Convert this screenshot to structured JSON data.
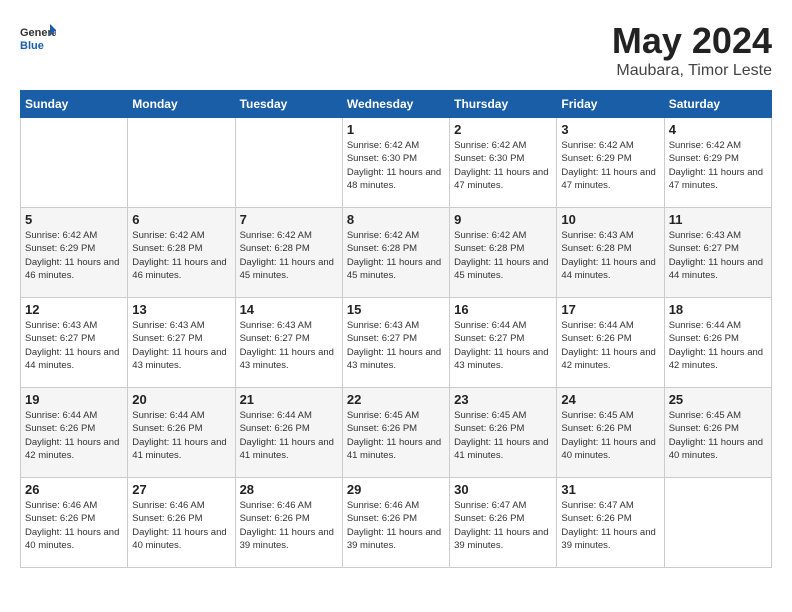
{
  "header": {
    "logo_general": "General",
    "logo_blue": "Blue",
    "title": "May 2024",
    "location": "Maubara, Timor Leste"
  },
  "weekdays": [
    "Sunday",
    "Monday",
    "Tuesday",
    "Wednesday",
    "Thursday",
    "Friday",
    "Saturday"
  ],
  "weeks": [
    [
      null,
      null,
      null,
      {
        "day": "1",
        "sunrise": "Sunrise: 6:42 AM",
        "sunset": "Sunset: 6:30 PM",
        "daylight": "Daylight: 11 hours and 48 minutes."
      },
      {
        "day": "2",
        "sunrise": "Sunrise: 6:42 AM",
        "sunset": "Sunset: 6:30 PM",
        "daylight": "Daylight: 11 hours and 47 minutes."
      },
      {
        "day": "3",
        "sunrise": "Sunrise: 6:42 AM",
        "sunset": "Sunset: 6:29 PM",
        "daylight": "Daylight: 11 hours and 47 minutes."
      },
      {
        "day": "4",
        "sunrise": "Sunrise: 6:42 AM",
        "sunset": "Sunset: 6:29 PM",
        "daylight": "Daylight: 11 hours and 47 minutes."
      }
    ],
    [
      {
        "day": "5",
        "sunrise": "Sunrise: 6:42 AM",
        "sunset": "Sunset: 6:29 PM",
        "daylight": "Daylight: 11 hours and 46 minutes."
      },
      {
        "day": "6",
        "sunrise": "Sunrise: 6:42 AM",
        "sunset": "Sunset: 6:28 PM",
        "daylight": "Daylight: 11 hours and 46 minutes."
      },
      {
        "day": "7",
        "sunrise": "Sunrise: 6:42 AM",
        "sunset": "Sunset: 6:28 PM",
        "daylight": "Daylight: 11 hours and 45 minutes."
      },
      {
        "day": "8",
        "sunrise": "Sunrise: 6:42 AM",
        "sunset": "Sunset: 6:28 PM",
        "daylight": "Daylight: 11 hours and 45 minutes."
      },
      {
        "day": "9",
        "sunrise": "Sunrise: 6:42 AM",
        "sunset": "Sunset: 6:28 PM",
        "daylight": "Daylight: 11 hours and 45 minutes."
      },
      {
        "day": "10",
        "sunrise": "Sunrise: 6:43 AM",
        "sunset": "Sunset: 6:28 PM",
        "daylight": "Daylight: 11 hours and 44 minutes."
      },
      {
        "day": "11",
        "sunrise": "Sunrise: 6:43 AM",
        "sunset": "Sunset: 6:27 PM",
        "daylight": "Daylight: 11 hours and 44 minutes."
      }
    ],
    [
      {
        "day": "12",
        "sunrise": "Sunrise: 6:43 AM",
        "sunset": "Sunset: 6:27 PM",
        "daylight": "Daylight: 11 hours and 44 minutes."
      },
      {
        "day": "13",
        "sunrise": "Sunrise: 6:43 AM",
        "sunset": "Sunset: 6:27 PM",
        "daylight": "Daylight: 11 hours and 43 minutes."
      },
      {
        "day": "14",
        "sunrise": "Sunrise: 6:43 AM",
        "sunset": "Sunset: 6:27 PM",
        "daylight": "Daylight: 11 hours and 43 minutes."
      },
      {
        "day": "15",
        "sunrise": "Sunrise: 6:43 AM",
        "sunset": "Sunset: 6:27 PM",
        "daylight": "Daylight: 11 hours and 43 minutes."
      },
      {
        "day": "16",
        "sunrise": "Sunrise: 6:44 AM",
        "sunset": "Sunset: 6:27 PM",
        "daylight": "Daylight: 11 hours and 43 minutes."
      },
      {
        "day": "17",
        "sunrise": "Sunrise: 6:44 AM",
        "sunset": "Sunset: 6:26 PM",
        "daylight": "Daylight: 11 hours and 42 minutes."
      },
      {
        "day": "18",
        "sunrise": "Sunrise: 6:44 AM",
        "sunset": "Sunset: 6:26 PM",
        "daylight": "Daylight: 11 hours and 42 minutes."
      }
    ],
    [
      {
        "day": "19",
        "sunrise": "Sunrise: 6:44 AM",
        "sunset": "Sunset: 6:26 PM",
        "daylight": "Daylight: 11 hours and 42 minutes."
      },
      {
        "day": "20",
        "sunrise": "Sunrise: 6:44 AM",
        "sunset": "Sunset: 6:26 PM",
        "daylight": "Daylight: 11 hours and 41 minutes."
      },
      {
        "day": "21",
        "sunrise": "Sunrise: 6:44 AM",
        "sunset": "Sunset: 6:26 PM",
        "daylight": "Daylight: 11 hours and 41 minutes."
      },
      {
        "day": "22",
        "sunrise": "Sunrise: 6:45 AM",
        "sunset": "Sunset: 6:26 PM",
        "daylight": "Daylight: 11 hours and 41 minutes."
      },
      {
        "day": "23",
        "sunrise": "Sunrise: 6:45 AM",
        "sunset": "Sunset: 6:26 PM",
        "daylight": "Daylight: 11 hours and 41 minutes."
      },
      {
        "day": "24",
        "sunrise": "Sunrise: 6:45 AM",
        "sunset": "Sunset: 6:26 PM",
        "daylight": "Daylight: 11 hours and 40 minutes."
      },
      {
        "day": "25",
        "sunrise": "Sunrise: 6:45 AM",
        "sunset": "Sunset: 6:26 PM",
        "daylight": "Daylight: 11 hours and 40 minutes."
      }
    ],
    [
      {
        "day": "26",
        "sunrise": "Sunrise: 6:46 AM",
        "sunset": "Sunset: 6:26 PM",
        "daylight": "Daylight: 11 hours and 40 minutes."
      },
      {
        "day": "27",
        "sunrise": "Sunrise: 6:46 AM",
        "sunset": "Sunset: 6:26 PM",
        "daylight": "Daylight: 11 hours and 40 minutes."
      },
      {
        "day": "28",
        "sunrise": "Sunrise: 6:46 AM",
        "sunset": "Sunset: 6:26 PM",
        "daylight": "Daylight: 11 hours and 39 minutes."
      },
      {
        "day": "29",
        "sunrise": "Sunrise: 6:46 AM",
        "sunset": "Sunset: 6:26 PM",
        "daylight": "Daylight: 11 hours and 39 minutes."
      },
      {
        "day": "30",
        "sunrise": "Sunrise: 6:47 AM",
        "sunset": "Sunset: 6:26 PM",
        "daylight": "Daylight: 11 hours and 39 minutes."
      },
      {
        "day": "31",
        "sunrise": "Sunrise: 6:47 AM",
        "sunset": "Sunset: 6:26 PM",
        "daylight": "Daylight: 11 hours and 39 minutes."
      },
      null
    ]
  ]
}
